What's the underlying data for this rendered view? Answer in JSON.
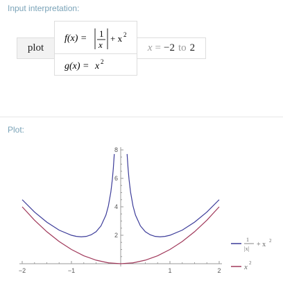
{
  "input_interpretation": {
    "title": "Input interpretation:",
    "command": "plot",
    "f_def": {
      "lhs": "f(x) =",
      "num": "1",
      "den": "x",
      "rest": "+ x",
      "exp": "2"
    },
    "g_def": {
      "lhs": "g(x) =",
      "base": "x",
      "exp": "2"
    },
    "range": {
      "var": "x",
      "eq": "=",
      "from": "−2",
      "to_word": "to",
      "to": "2"
    }
  },
  "plot": {
    "title": "Plot:"
  },
  "chart_data": {
    "type": "line",
    "xlim": [
      -2,
      2
    ],
    "ylim": [
      0,
      8
    ],
    "x_ticks": [
      -2,
      -1,
      1,
      2
    ],
    "x_tick_labels": [
      "−2",
      "−1",
      "1",
      "2"
    ],
    "y_ticks": [
      2,
      4,
      6,
      8
    ],
    "y_tick_labels": [
      "2",
      "4",
      "6",
      "8"
    ],
    "grid": false,
    "legend_position": "bottom-right",
    "series": [
      {
        "name": "1/|x| + x^2",
        "legend": {
          "num": "1",
          "den": "|x|",
          "rest": "+ x",
          "exp": "2"
        },
        "color": "#3b3b99",
        "x": [
          -2,
          -1.75,
          -1.5,
          -1.25,
          -1,
          -0.9,
          -0.8,
          -0.7,
          -0.6,
          -0.5,
          -0.4,
          -0.3,
          -0.25,
          -0.2,
          -0.17,
          -0.15,
          -0.13,
          0.13,
          0.15,
          0.17,
          0.2,
          0.25,
          0.3,
          0.4,
          0.5,
          0.6,
          0.7,
          0.8,
          0.9,
          1,
          1.25,
          1.5,
          1.75,
          2
        ],
        "y": [
          4.5,
          3.63,
          2.92,
          2.36,
          2.0,
          1.92,
          1.89,
          1.92,
          2.03,
          2.25,
          2.66,
          3.42,
          4.06,
          5.04,
          5.91,
          6.69,
          7.71,
          7.71,
          6.69,
          5.91,
          5.04,
          4.06,
          3.42,
          2.66,
          2.25,
          2.03,
          1.92,
          1.89,
          1.92,
          2.0,
          2.36,
          2.92,
          3.63,
          4.5
        ]
      },
      {
        "name": "x^2",
        "legend": {
          "base": "x",
          "exp": "2"
        },
        "color": "#a0385a",
        "x": [
          -2,
          -1.75,
          -1.5,
          -1.25,
          -1,
          -0.75,
          -0.5,
          -0.25,
          0,
          0.25,
          0.5,
          0.75,
          1,
          1.25,
          1.5,
          1.75,
          2
        ],
        "y": [
          4.0,
          3.06,
          2.25,
          1.56,
          1.0,
          0.56,
          0.25,
          0.06,
          0,
          0.06,
          0.25,
          0.56,
          1.0,
          1.56,
          2.25,
          3.06,
          4.0
        ]
      }
    ]
  }
}
